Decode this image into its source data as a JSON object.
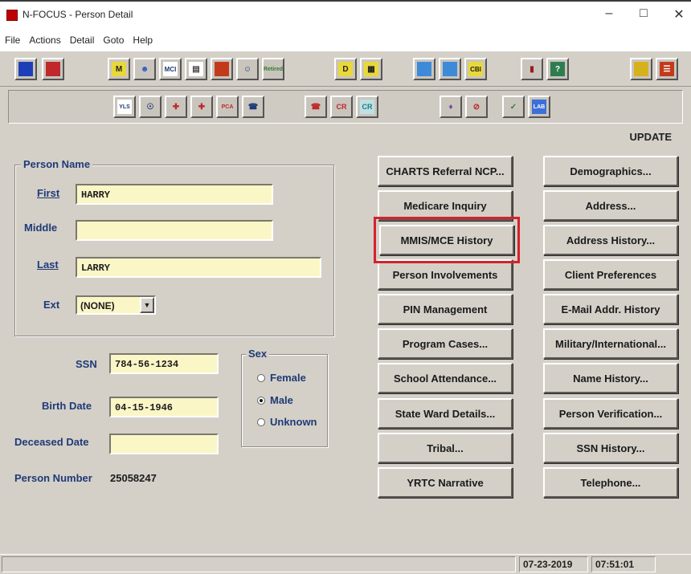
{
  "window": {
    "title": "N-FOCUS - Person Detail"
  },
  "menu": [
    "File",
    "Actions",
    "Detail",
    "Goto",
    "Help"
  ],
  "toolbar1": [
    "M",
    "MCI",
    "CBI",
    "?",
    "Retired"
  ],
  "toolbar2": [
    "YLS",
    "PCA",
    "CR",
    "CR",
    "LAB"
  ],
  "mode": "UPDATE",
  "person_name": {
    "group_title": "Person Name",
    "first_label": "First",
    "first_value": "HARRY",
    "middle_label": "Middle",
    "middle_value": "",
    "last_label": "Last",
    "last_value": "LARRY",
    "ext_label": "Ext",
    "ext_value": "(NONE)"
  },
  "ssn": {
    "label": "SSN",
    "value": "784-56-1234"
  },
  "birth_date": {
    "label": "Birth Date",
    "value": "04-15-1946"
  },
  "deceased_date": {
    "label": "Deceased Date",
    "value": ""
  },
  "person_number": {
    "label": "Person Number",
    "value": "25058247"
  },
  "sex": {
    "group_title": "Sex",
    "options": [
      "Female",
      "Male",
      "Unknown"
    ],
    "selected": "Male"
  },
  "buttons_left": [
    "CHARTS Referral NCP...",
    "Medicare Inquiry",
    "MMIS/MCE History",
    "Person Involvements",
    "PIN Management",
    "Program Cases...",
    "School Attendance...",
    "State Ward Details...",
    "Tribal...",
    "YRTC Narrative"
  ],
  "buttons_right": [
    "Demographics...",
    "Address...",
    "Address History...",
    "Client Preferences",
    "E-Mail Addr. History",
    "Military/International...",
    "Name History...",
    "Person Verification...",
    "SSN History...",
    "Telephone..."
  ],
  "highlighted_button": "MMIS/MCE History",
  "status": {
    "date": "07-23-2019",
    "time": "07:51:01"
  },
  "colors": {
    "highlight": "#d6212b",
    "field_bg": "#fbf6c6",
    "label": "#1f3a77"
  }
}
